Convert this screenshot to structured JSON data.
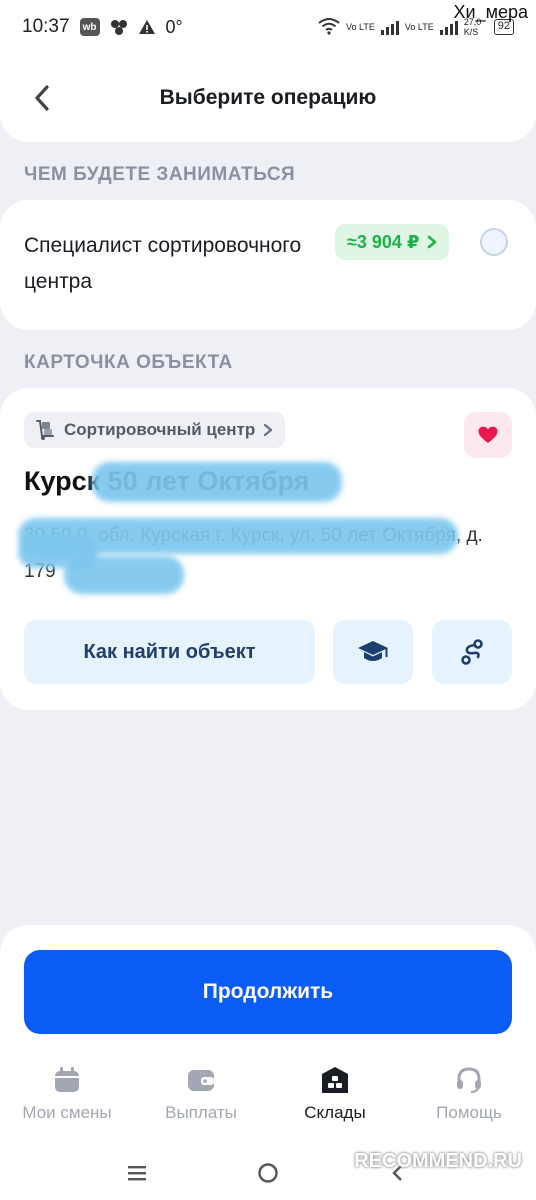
{
  "status_bar": {
    "time": "10:37",
    "left_icons": [
      "wb-icon",
      "cluster-icon",
      "warning-icon"
    ],
    "temperature": "0°",
    "network_speed": "27,0 K/S",
    "volte_1": "Vo LTE",
    "volte_2": "Vo LTE",
    "battery": "92"
  },
  "watermark_top": "Хи_мера",
  "header": {
    "title": "Выберите операцию",
    "back_icon": "chevron-left-icon"
  },
  "sections": {
    "job_label": "ЧЕМ БУДЕТЕ ЗАНИМАТЬСЯ",
    "object_label": "КАРТОЧКА ОБЪЕКТА"
  },
  "job": {
    "title": "Специалист сортировочного центра",
    "price": "≈3 904 ₽",
    "selected": false
  },
  "object": {
    "type": "Сортировочный центр",
    "name": "Курск 50 лет Октября",
    "address": "30 50 0, обл. Курская г. Курск, ул. 50 лет Октября, д. 179",
    "favorite": true,
    "find_button": "Как найти объект",
    "education_icon": "graduation-cap-icon",
    "route_icon": "route-icon"
  },
  "colors": {
    "accent": "#0a5cf5",
    "price_green": "#1fb04a",
    "heart": "#e8174d",
    "redaction": "#7cc6ee"
  },
  "continue_button": "Продолжить",
  "tabs": [
    {
      "label": "Мои смены",
      "icon": "calendar-icon",
      "active": false
    },
    {
      "label": "Выплаты",
      "icon": "wallet-icon",
      "active": false
    },
    {
      "label": "Склады",
      "icon": "warehouse-icon",
      "active": true
    },
    {
      "label": "Помощь",
      "icon": "headset-icon",
      "active": false
    }
  ],
  "watermark_bottom": "RECOMMEND.RU"
}
